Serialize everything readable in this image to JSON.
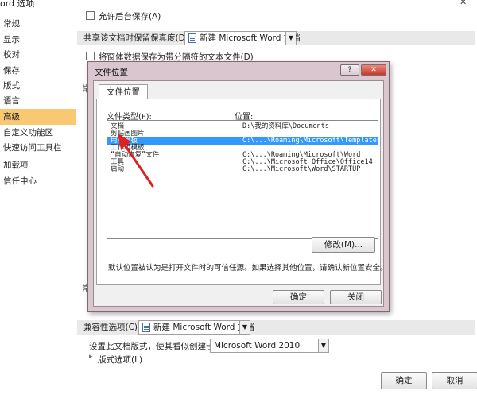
{
  "window": {
    "title": "ord 选项",
    "close_glyph": "✕"
  },
  "nav": {
    "items": [
      {
        "label": "常规"
      },
      {
        "label": "显示"
      },
      {
        "label": "校对"
      },
      {
        "label": "保存"
      },
      {
        "label": "版式"
      },
      {
        "label": "语言"
      },
      {
        "label": "高级",
        "selected": true
      },
      {
        "label": "自定义功能区"
      },
      {
        "label": "快速访问工具栏"
      },
      {
        "label": "加载项"
      },
      {
        "label": "信任中心"
      }
    ]
  },
  "main": {
    "allow_background_save": "允许后台保存(A)",
    "preserve_fidelity_label": "共享该文档时保留保真度(D):",
    "preserve_fidelity_doc": "新建 Microsoft Word 文档",
    "save_form_data": "将窗体数据保存为带分隔符的文本文件(D)",
    "partial_header_1": "常",
    "partial_header_2": "常",
    "compat_label": "兼容性选项(C):",
    "compat_doc": "新建 Microsoft Word 文档",
    "layout_as_label": "设置此文档版式，使其看似创建于(U):",
    "layout_as_value": "Microsoft Word 2010",
    "layout_options": "版式选项(L)",
    "expand_glyph": "▸",
    "dropdown_glyph": "▼"
  },
  "bottom": {
    "ok": "确定",
    "cancel": "取消"
  },
  "dialog": {
    "title": "文件位置",
    "help_glyph": "?",
    "close_glyph": "✕",
    "tab": "文件位置",
    "col_type": "文件类型(F):",
    "col_location": "位置:",
    "rows": [
      {
        "type": "文档",
        "location": "D:\\我的资料库\\Documents"
      },
      {
        "type": "剪贴画图片",
        "location": ""
      },
      {
        "type": "用户模板",
        "location": "C:\\...\\Roaming\\Microsoft\\Templates",
        "selected": true
      },
      {
        "type": "工作组模板",
        "location": ""
      },
      {
        "type": "“自动恢复”文件",
        "location": "C:\\...\\Roaming\\Microsoft\\Word"
      },
      {
        "type": "工具",
        "location": "C:\\...\\Microsoft Office\\Office14"
      },
      {
        "type": "启动",
        "location": "C:\\...\\Microsoft\\Word\\STARTUP"
      }
    ],
    "modify_button": "修改(M)...",
    "note": "默认位置被认为是打开文件时的可信任源。如果选择其他位置，请确认新位置安全。",
    "ok": "确定",
    "close": "关闭"
  },
  "colors": {
    "nav_selected": "#f9c873",
    "list_selected": "#3399ff",
    "dialog_frame": "#d9c6cf",
    "annotation_arrow": "#e02020"
  }
}
